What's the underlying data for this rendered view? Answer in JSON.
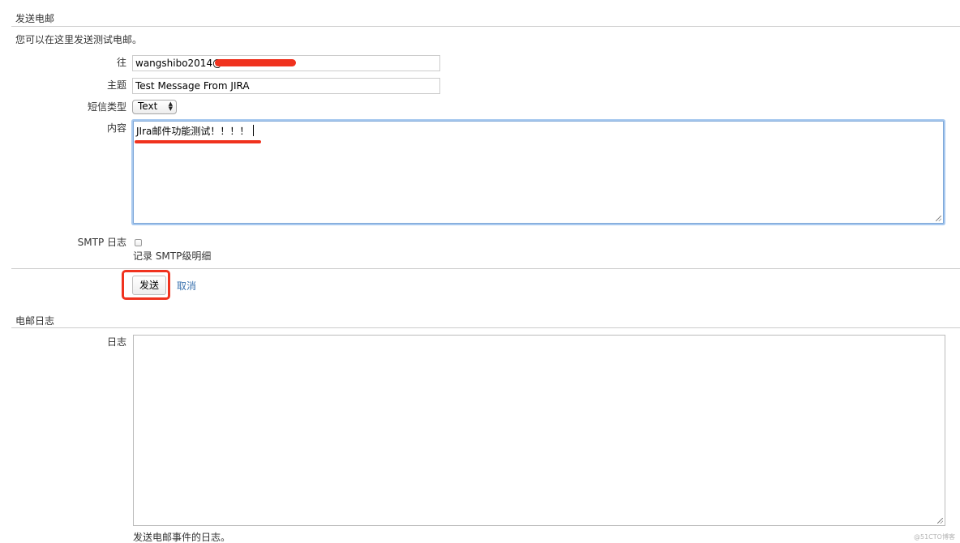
{
  "send_section": {
    "title": "发送电邮",
    "description": "您可以在这里发送测试电邮。"
  },
  "form": {
    "to_label": "往",
    "to_value": "wangshibo2014@",
    "subject_label": "主题",
    "subject_value": "Test Message From JIRA",
    "message_type_label": "短信类型",
    "message_type_value": "Text",
    "body_label": "内容",
    "body_value": "JIra邮件功能测试！！！！",
    "smtp_log_label": "SMTP 日志",
    "smtp_log_checkbox_text": "记录 SMTP级明细",
    "smtp_log_checked": false,
    "send_label": "发送",
    "cancel_label": "取消"
  },
  "log_section": {
    "title": "电邮日志",
    "log_label": "日志",
    "log_help": "发送电邮事件的日志。"
  },
  "annotations": {
    "highlight_color": "#f0321e",
    "watermark": "@51CTO博客"
  },
  "colors": {
    "link": "#3b73af",
    "focus_ring": "#a8c9ef",
    "divider": "#cccccc"
  }
}
